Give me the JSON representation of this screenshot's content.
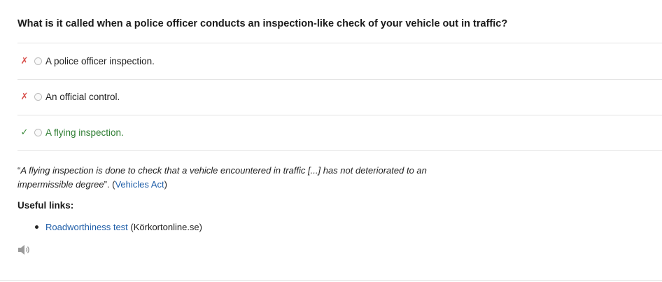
{
  "question": "What is it called when a police officer conducts an inspection-like check of your vehicle out in traffic?",
  "options": [
    {
      "mark": "✗",
      "label": "A police officer inspection.",
      "status": "incorrect"
    },
    {
      "mark": "✗",
      "label": "An official control.",
      "status": "incorrect"
    },
    {
      "mark": "✓",
      "label": "A flying inspection.",
      "status": "correct"
    }
  ],
  "explanation": {
    "open_quote": "“",
    "quote_part1": "A flying inspection is done to check that a vehicle encountered in traffic [...] has not deteriorated to an",
    "quote_part2": "impermissible degree",
    "close_quote": "”. (",
    "source_link": "Vehicles Act",
    "close_paren": ")"
  },
  "useful_links": {
    "heading": "Useful links:",
    "items": [
      {
        "link_text": "Roadworthiness test",
        "suffix": " (Körkortonline.se)"
      }
    ]
  },
  "audio": {
    "icon": "speaker-icon"
  },
  "colors": {
    "wrong": "#d9534f",
    "correct": "#2e7d32",
    "link": "#1f5ea8",
    "divider": "#e4e4e4"
  }
}
